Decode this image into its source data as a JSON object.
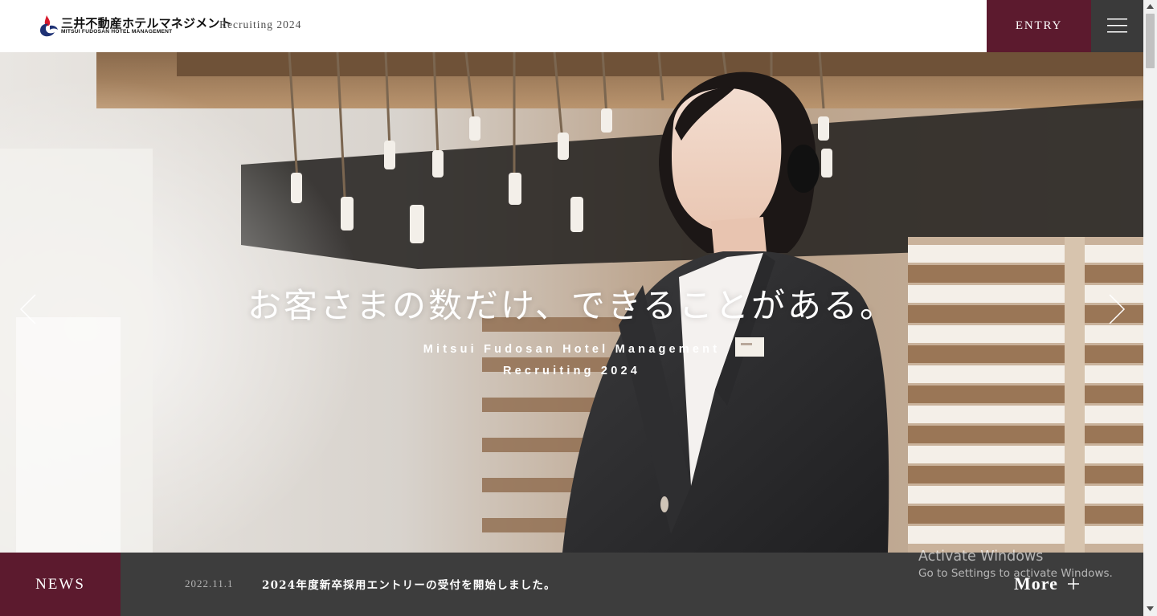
{
  "header": {
    "logo_jp": "三井不動産ホテルマネジメント",
    "logo_en": "MITSUI FUDOSAN HOTEL MANAGEMENT",
    "recruit_label": "Recruiting 2024",
    "entry_label": "ENTRY",
    "menu_icon": "hamburger-menu-icon"
  },
  "hero": {
    "catchcopy": "お客さまの数だけ、できることがある。",
    "sub_line1": "Mitsui Fudosan Hotel Management",
    "sub_line2": "Recruiting 2024",
    "prev_icon": "chevron-left-icon",
    "next_icon": "chevron-right-icon"
  },
  "news": {
    "label": "NEWS",
    "date": "2022.11.1",
    "title": "2024年度新卒採用エントリーの受付を開始しました。",
    "more_label": "More",
    "more_icon": "plus-icon"
  },
  "os_overlay": {
    "title": "Activate Windows",
    "subtitle": "Go to Settings to activate Windows."
  },
  "colors": {
    "brand_burgundy": "#5c1a2e",
    "dark_gray": "#3d3d3d",
    "menu_gray": "#3a3a3a",
    "logo_red": "#d7192c",
    "logo_navy": "#1f3275"
  }
}
